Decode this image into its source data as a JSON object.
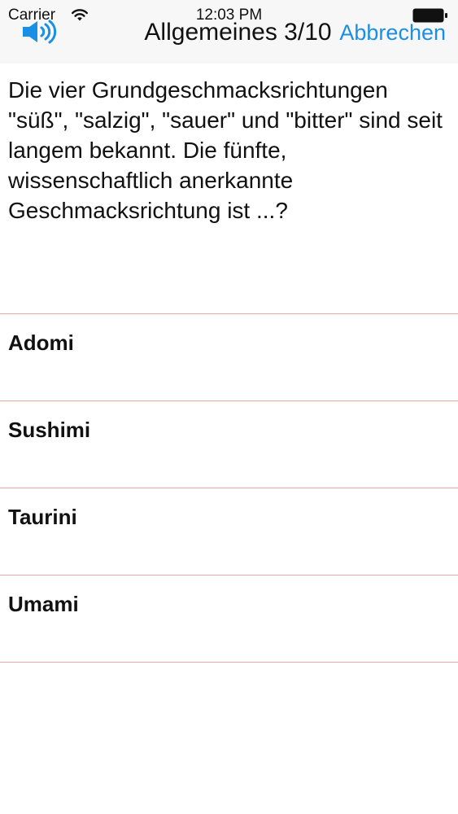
{
  "status_bar": {
    "carrier": "Carrier",
    "time": "12:03 PM"
  },
  "nav": {
    "title": "Allgemeines 3/10",
    "cancel_label": "Abbrechen",
    "accent_color": "#1a8fe6"
  },
  "question": {
    "text": "Die vier Grundgeschmacksrichtungen \"süß\", \"salzig\", \"sauer\" und \"bitter\" sind seit langem bekannt. Die fünfte, wissenschaftlich anerkannte Geschmacksrichtung ist ...?"
  },
  "answers": [
    {
      "label": "Adomi"
    },
    {
      "label": "Sushimi"
    },
    {
      "label": "Taurini"
    },
    {
      "label": "Umami"
    }
  ],
  "divider_color": "#e8a8a4",
  "icons": {
    "sound": "speaker-icon",
    "wifi": "wifi-icon",
    "battery": "battery-icon"
  }
}
